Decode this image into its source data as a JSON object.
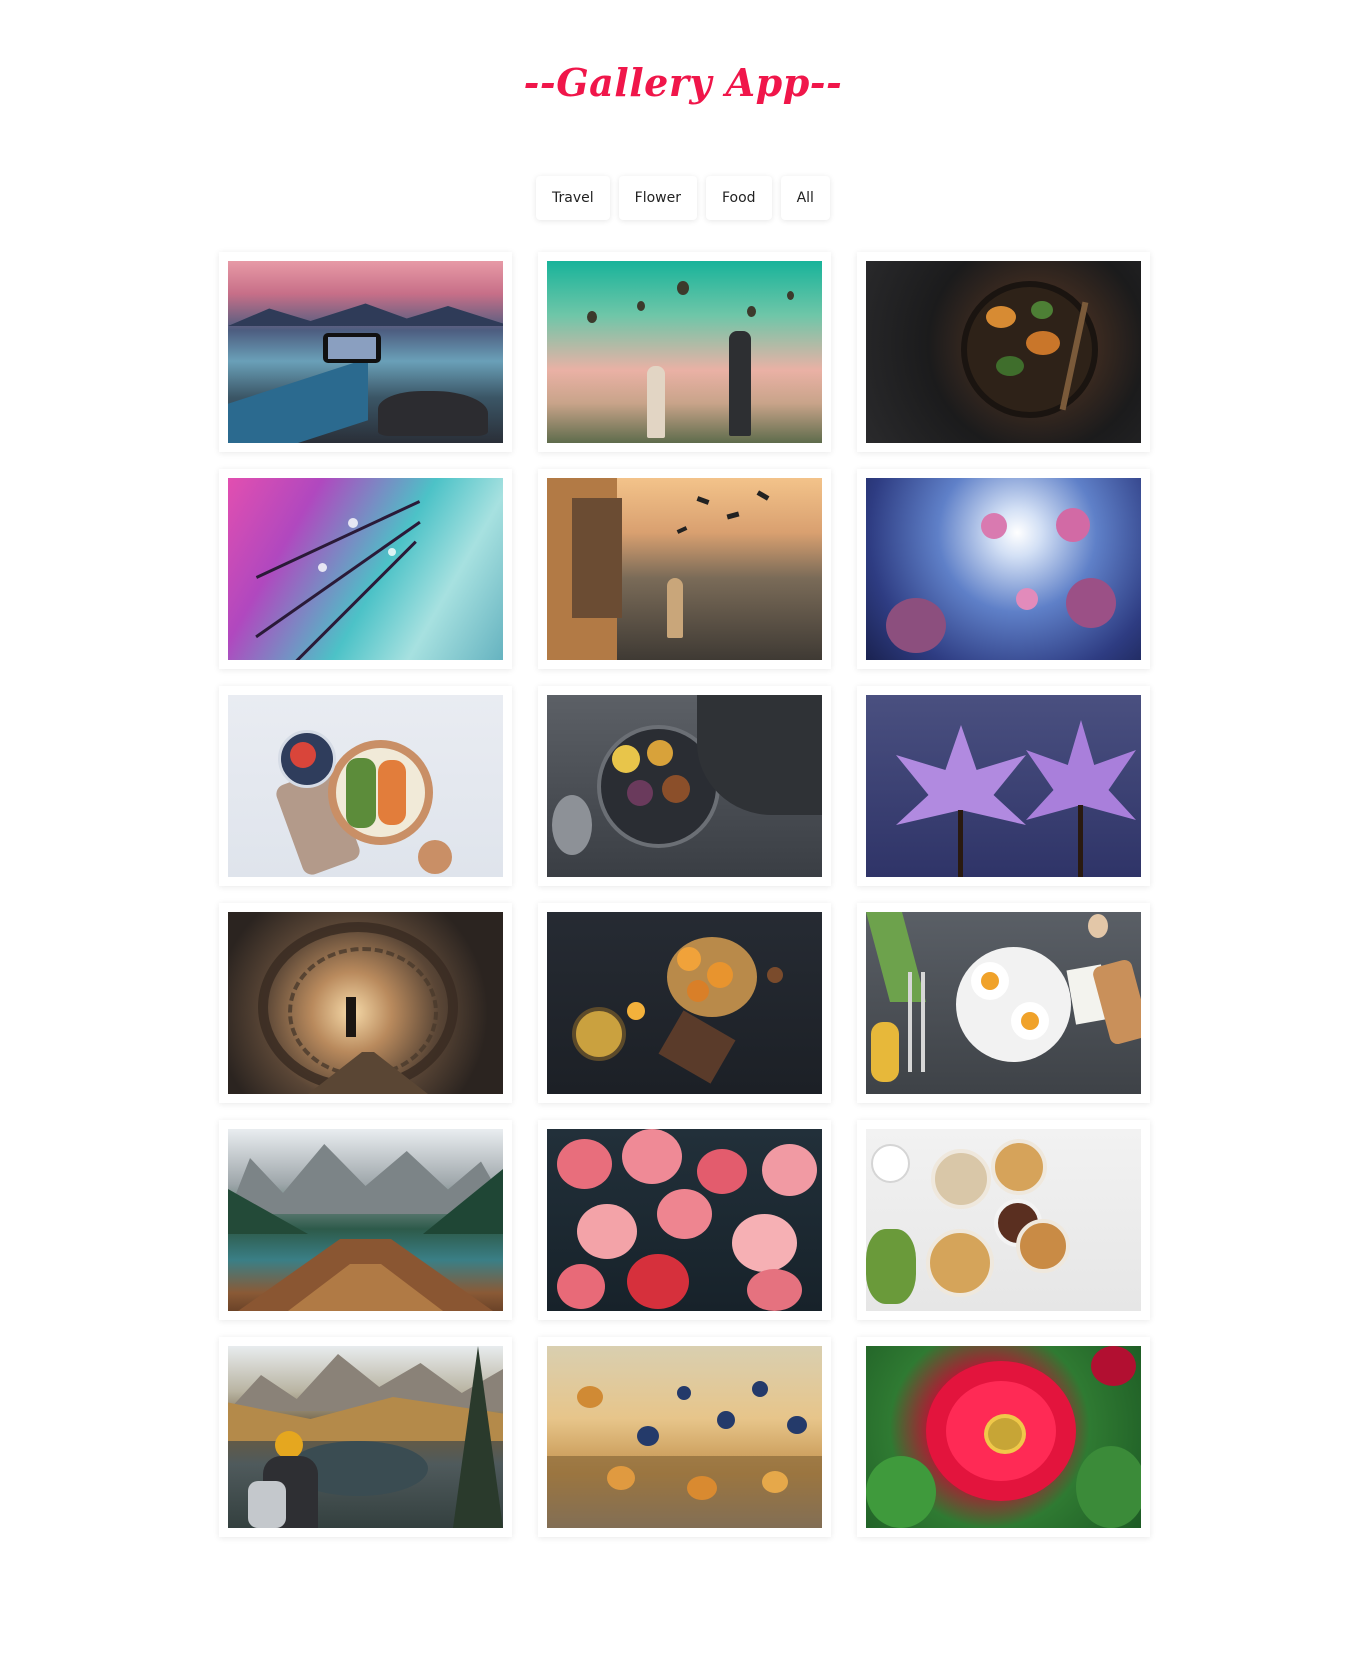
{
  "app": {
    "title": "--Gallery App--"
  },
  "filters": [
    {
      "label": "Travel"
    },
    {
      "label": "Flower"
    },
    {
      "label": "Food"
    },
    {
      "label": "All"
    }
  ],
  "colors": {
    "title": "#f0164a",
    "background": "#ffffff"
  },
  "gallery": {
    "items": [
      {
        "name": "travel-photo-lake-mountains-phone"
      },
      {
        "name": "travel-photo-hot-air-balloons"
      },
      {
        "name": "food-photo-pan-vegetables"
      },
      {
        "name": "flower-photo-dew-petals"
      },
      {
        "name": "travel-photo-street-birds"
      },
      {
        "name": "flower-photo-cosmos-sky"
      },
      {
        "name": "food-photo-salad-board"
      },
      {
        "name": "food-photo-fruit-platter"
      },
      {
        "name": "flower-photo-water-lilies"
      },
      {
        "name": "travel-photo-fisherman-net"
      },
      {
        "name": "food-photo-citrus-spices"
      },
      {
        "name": "food-photo-breakfast-eggs"
      },
      {
        "name": "travel-photo-boat-lake"
      },
      {
        "name": "flower-photo-pink-blossoms"
      },
      {
        "name": "food-photo-breakfast-bowls"
      },
      {
        "name": "travel-photo-hiker-lake"
      },
      {
        "name": "flower-photo-field-sunset"
      },
      {
        "name": "flower-photo-red-zinnia"
      }
    ]
  }
}
